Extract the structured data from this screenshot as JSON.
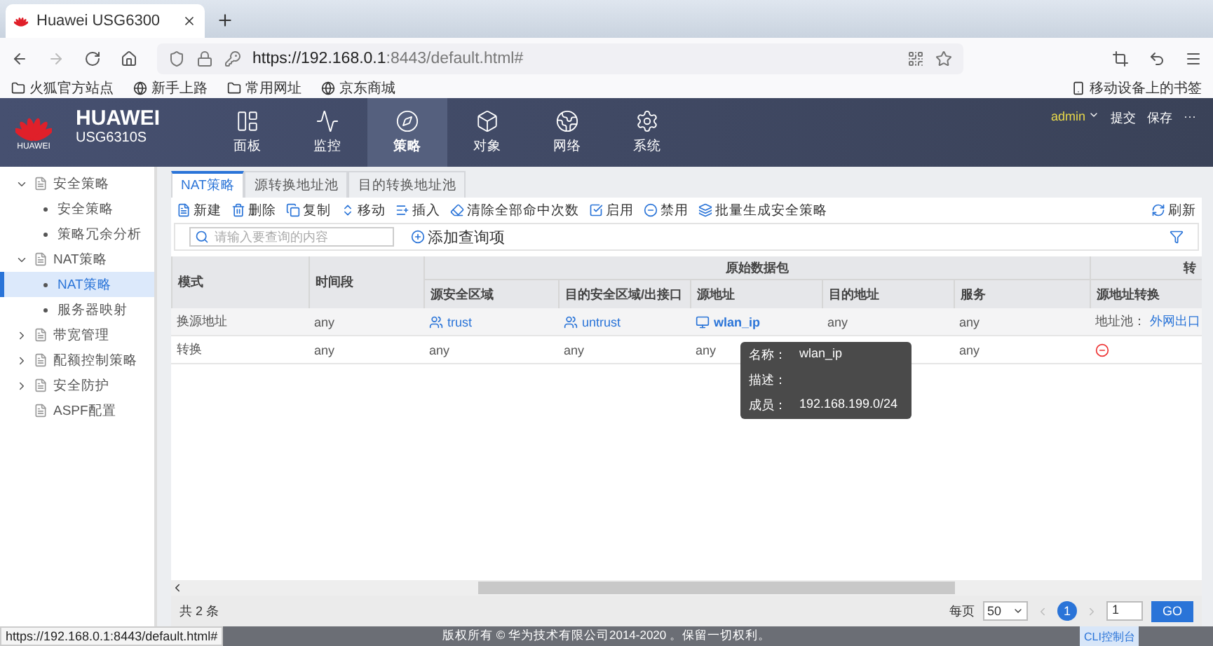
{
  "browser": {
    "tab_title": "Huawei USG6300",
    "url_host": "https://192.168.0.1",
    "url_rest": ":8443/default.html#",
    "bookmarks": [
      {
        "label": "火狐官方站点",
        "kind": "folder"
      },
      {
        "label": "新手上路",
        "kind": "firefox"
      },
      {
        "label": "常用网址",
        "kind": "folder"
      },
      {
        "label": "京东商城",
        "kind": "globe"
      }
    ],
    "mobile_bookmarks": "移动设备上的书签"
  },
  "header": {
    "brand": "HUAWEI",
    "logo_text": "HUAWEI",
    "model": "USG6310S",
    "user": "admin",
    "actions": [
      "提交",
      "保存"
    ],
    "more": "···",
    "nav": [
      {
        "label": "面板",
        "kind": "panel",
        "selected": false
      },
      {
        "label": "监控",
        "kind": "monitor",
        "selected": false
      },
      {
        "label": "策略",
        "kind": "compass",
        "selected": true
      },
      {
        "label": "对象",
        "kind": "object",
        "selected": false
      },
      {
        "label": "网络",
        "kind": "network",
        "selected": false
      },
      {
        "label": "系统",
        "kind": "gear",
        "selected": false
      }
    ]
  },
  "sidebar": {
    "items": [
      {
        "label": "安全策略",
        "expanded": true,
        "children": [
          {
            "label": "安全策略",
            "selected": false
          },
          {
            "label": "策略冗余分析",
            "selected": false
          }
        ]
      },
      {
        "label": "NAT策略",
        "expanded": true,
        "children": [
          {
            "label": "NAT策略",
            "selected": true
          },
          {
            "label": "服务器映射",
            "selected": false
          }
        ]
      },
      {
        "label": "带宽管理",
        "expanded": false
      },
      {
        "label": "配额控制策略",
        "expanded": false
      },
      {
        "label": "安全防护",
        "expanded": false
      },
      {
        "label": "ASPF配置"
      }
    ]
  },
  "tabs": [
    {
      "label": "NAT策略",
      "selected": true
    },
    {
      "label": "源转换地址池",
      "selected": false
    },
    {
      "label": "目的转换地址池",
      "selected": false
    }
  ],
  "toolbar": [
    {
      "label": "新建",
      "kind": "new"
    },
    {
      "label": "删除",
      "kind": "delete"
    },
    {
      "label": "复制",
      "kind": "copy"
    },
    {
      "label": "移动",
      "kind": "move"
    },
    {
      "label": "插入",
      "kind": "insert"
    },
    {
      "label": "清除全部命中次数",
      "kind": "clear"
    },
    {
      "label": "启用",
      "kind": "enable"
    },
    {
      "label": "禁用",
      "kind": "disable"
    },
    {
      "label": "批量生成安全策略",
      "kind": "batch"
    }
  ],
  "refresh": "刷新",
  "search": {
    "placeholder": "请输入要查询的内容",
    "add": "添加查询项"
  },
  "table": {
    "groups": [
      "原始数据包",
      "转"
    ],
    "columns": [
      "模式",
      "时间段",
      "源安全区域",
      "目的安全区域/出接口",
      "源地址",
      "目的地址",
      "服务",
      "源地址转换"
    ],
    "rows": [
      [
        {
          "text": "换源地址",
          "kind": "plain"
        },
        {
          "text": "any",
          "kind": "plain"
        },
        {
          "text": "trust",
          "kind": "zone"
        },
        {
          "text": "untrust",
          "kind": "zone"
        },
        {
          "text": "wlan_ip",
          "kind": "address"
        },
        {
          "text": "any",
          "kind": "plain"
        },
        {
          "text": "any",
          "kind": "plain"
        },
        {
          "text": "地址池：",
          "link": "外网出口",
          "kind": "pool"
        }
      ],
      [
        {
          "text": "转换",
          "kind": "plain"
        },
        {
          "text": "any",
          "kind": "plain"
        },
        {
          "text": "any",
          "kind": "plain"
        },
        {
          "text": "any",
          "kind": "plain"
        },
        {
          "text": "any",
          "kind": "plain"
        },
        {
          "kind": "covered"
        },
        {
          "text": "any",
          "kind": "plain"
        },
        {
          "kind": "none"
        }
      ]
    ]
  },
  "tooltip": [
    {
      "label": "名称：",
      "value": "wlan_ip"
    },
    {
      "label": "描述："
    },
    {
      "label": "成员：",
      "value": "192.168.199.0/24"
    }
  ],
  "pager": {
    "total": "共 2 条",
    "per_page_label": "每页",
    "per_page": "50",
    "page": "1",
    "jump": "1",
    "go": "GO"
  },
  "cli": "CLI控制台",
  "footer": "版权所有 © 华为技术有限公司2014-2020 。保留一切权利。",
  "status_url": "https://192.168.0.1:8443/default.html#"
}
